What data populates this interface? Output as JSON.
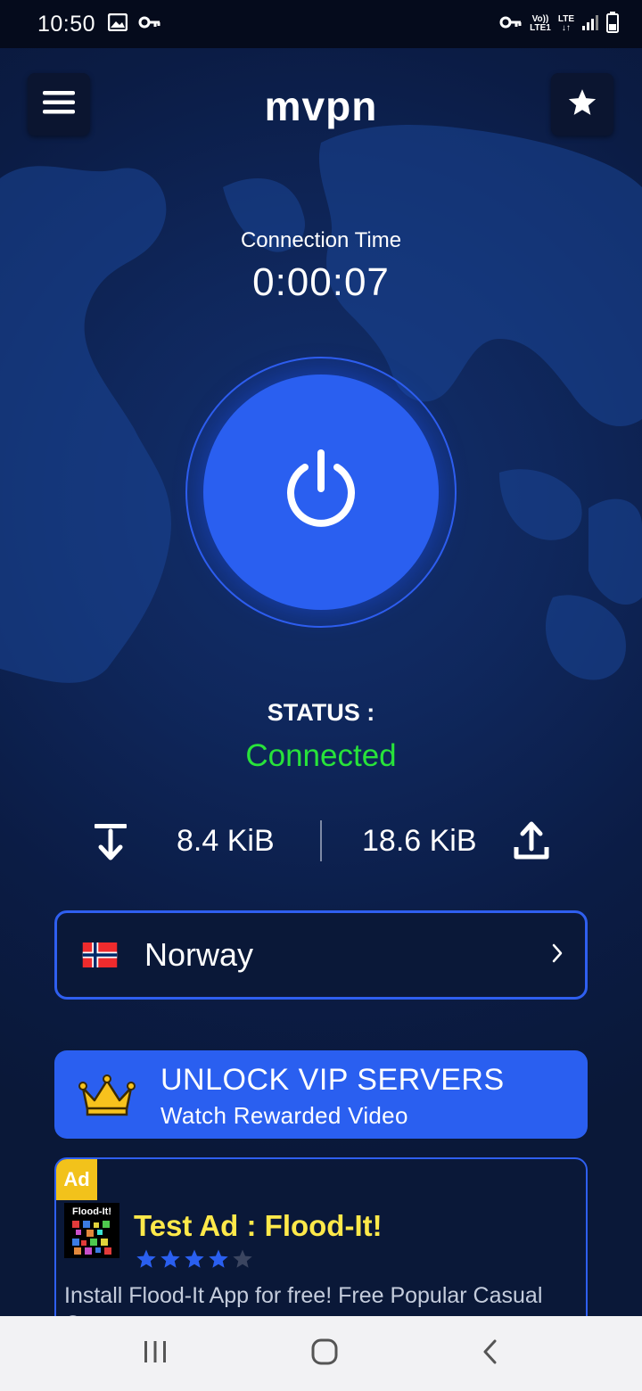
{
  "status_bar": {
    "time": "10:50",
    "left_icons": [
      "image-icon",
      "key-icon"
    ],
    "right_icons": [
      "vpn-key-icon",
      "volte-icon",
      "lte-data-icon",
      "signal-icon",
      "battery-icon"
    ],
    "volte_line1": "Vo))",
    "volte_line2": "LTE1",
    "lte_line1": "LTE",
    "lte_line2": "↓↑"
  },
  "header": {
    "title": "mvpn",
    "menu_icon": "menu-icon",
    "star_icon": "star-icon"
  },
  "connection": {
    "label": "Connection Time",
    "time": "0:00:07"
  },
  "power_icon": "power-icon",
  "status": {
    "label": "STATUS :",
    "value": "Connected",
    "value_color": "#28e33a"
  },
  "traffic": {
    "download": "8.4 KiB",
    "upload": "18.6 KiB",
    "download_icon": "download-icon",
    "upload_icon": "upload-icon"
  },
  "server": {
    "country": "Norway",
    "flag_icon": "norway-flag-icon",
    "chevron_icon": "chevron-right-icon"
  },
  "vip": {
    "title": "UNLOCK VIP SERVERS",
    "subtitle": "Watch Rewarded Video",
    "crown_icon": "crown-icon"
  },
  "ad": {
    "badge": "Ad",
    "logo_text": "Flood-It!",
    "title": "Test Ad : Flood-It!",
    "rating": 4,
    "rating_max": 5,
    "description": "Install Flood-It App for free! Free Popular Casual Game"
  },
  "nav_bar": {
    "recents_icon": "recents-icon",
    "home_icon": "home-icon",
    "back_icon": "back-icon"
  },
  "colors": {
    "accent": "#2a5ff0",
    "background": "#0a1838",
    "ad_title": "#ffe94a",
    "ad_badge": "#f2c21b"
  }
}
